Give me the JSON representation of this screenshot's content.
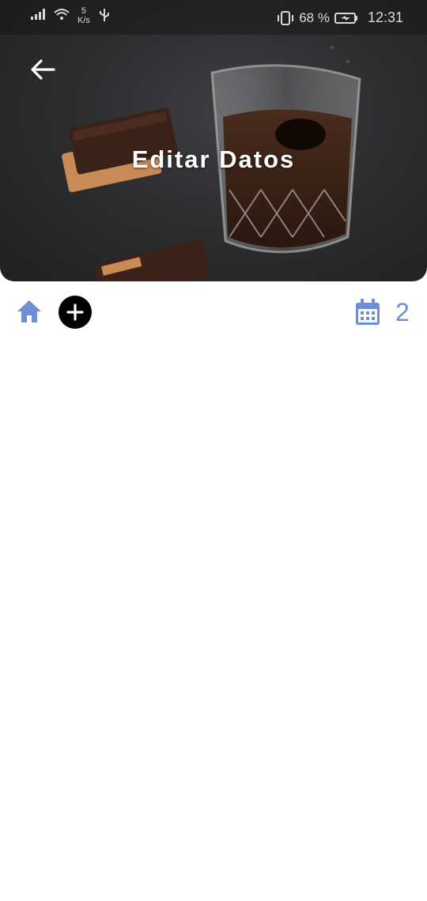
{
  "status_bar": {
    "net_speed_value": "5",
    "net_speed_unit": "K/s",
    "battery_percent": "68 %",
    "time": "12:31"
  },
  "header": {
    "title": "Editar Datos",
    "background_image": "chocolate-drink-photo"
  },
  "toolbar": {
    "home_icon": "home-icon",
    "add_icon": "plus-circle-icon",
    "calendar_icon": "calendar-icon",
    "count": "2"
  },
  "colors": {
    "accent": "#6f8fd4",
    "add_button_bg": "#000000",
    "title_text": "#ffffff"
  }
}
